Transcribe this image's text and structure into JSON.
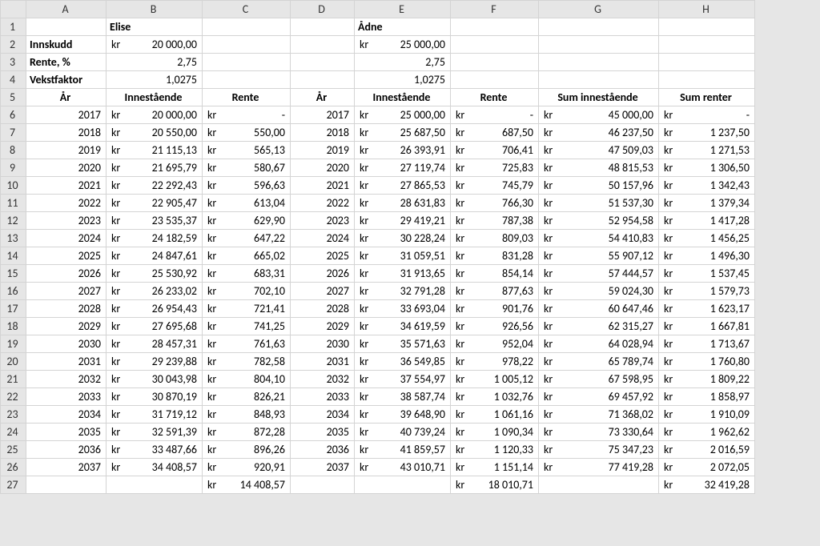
{
  "columns": [
    "A",
    "B",
    "C",
    "D",
    "E",
    "F",
    "G",
    "H"
  ],
  "row_count": 27,
  "labels": {
    "elise": "Elise",
    "adne": "Ådne",
    "innskudd": "Innskudd",
    "rente_pct": "Rente, %",
    "vekstfaktor": "Vekstfaktor",
    "ar": "År",
    "innestaende": "Innestående",
    "rente": "Rente",
    "sum_innestaende": "Sum innestående",
    "sum_renter": "Sum renter",
    "kr": "kr",
    "dash": "-"
  },
  "inputs": {
    "elise_innskudd": "20 000,00",
    "adne_innskudd": "25 000,00",
    "rente_pct": "2,75",
    "vekstfaktor": "1,0275"
  },
  "rows": [
    {
      "y": "2017",
      "eB": "20 000,00",
      "eR": "-",
      "aB": "25 000,00",
      "aR": "-",
      "sB": "45 000,00",
      "sR": "-"
    },
    {
      "y": "2018",
      "eB": "20 550,00",
      "eR": "550,00",
      "aB": "25 687,50",
      "aR": "687,50",
      "sB": "46 237,50",
      "sR": "1 237,50"
    },
    {
      "y": "2019",
      "eB": "21 115,13",
      "eR": "565,13",
      "aB": "26 393,91",
      "aR": "706,41",
      "sB": "47 509,03",
      "sR": "1 271,53"
    },
    {
      "y": "2020",
      "eB": "21 695,79",
      "eR": "580,67",
      "aB": "27 119,74",
      "aR": "725,83",
      "sB": "48 815,53",
      "sR": "1 306,50"
    },
    {
      "y": "2021",
      "eB": "22 292,43",
      "eR": "596,63",
      "aB": "27 865,53",
      "aR": "745,79",
      "sB": "50 157,96",
      "sR": "1 342,43"
    },
    {
      "y": "2022",
      "eB": "22 905,47",
      "eR": "613,04",
      "aB": "28 631,83",
      "aR": "766,30",
      "sB": "51 537,30",
      "sR": "1 379,34"
    },
    {
      "y": "2023",
      "eB": "23 535,37",
      "eR": "629,90",
      "aB": "29 419,21",
      "aR": "787,38",
      "sB": "52 954,58",
      "sR": "1 417,28"
    },
    {
      "y": "2024",
      "eB": "24 182,59",
      "eR": "647,22",
      "aB": "30 228,24",
      "aR": "809,03",
      "sB": "54 410,83",
      "sR": "1 456,25"
    },
    {
      "y": "2025",
      "eB": "24 847,61",
      "eR": "665,02",
      "aB": "31 059,51",
      "aR": "831,28",
      "sB": "55 907,12",
      "sR": "1 496,30"
    },
    {
      "y": "2026",
      "eB": "25 530,92",
      "eR": "683,31",
      "aB": "31 913,65",
      "aR": "854,14",
      "sB": "57 444,57",
      "sR": "1 537,45"
    },
    {
      "y": "2027",
      "eB": "26 233,02",
      "eR": "702,10",
      "aB": "32 791,28",
      "aR": "877,63",
      "sB": "59 024,30",
      "sR": "1 579,73"
    },
    {
      "y": "2028",
      "eB": "26 954,43",
      "eR": "721,41",
      "aB": "33 693,04",
      "aR": "901,76",
      "sB": "60 647,46",
      "sR": "1 623,17"
    },
    {
      "y": "2029",
      "eB": "27 695,68",
      "eR": "741,25",
      "aB": "34 619,59",
      "aR": "926,56",
      "sB": "62 315,27",
      "sR": "1 667,81"
    },
    {
      "y": "2030",
      "eB": "28 457,31",
      "eR": "761,63",
      "aB": "35 571,63",
      "aR": "952,04",
      "sB": "64 028,94",
      "sR": "1 713,67"
    },
    {
      "y": "2031",
      "eB": "29 239,88",
      "eR": "782,58",
      "aB": "36 549,85",
      "aR": "978,22",
      "sB": "65 789,74",
      "sR": "1 760,80"
    },
    {
      "y": "2032",
      "eB": "30 043,98",
      "eR": "804,10",
      "aB": "37 554,97",
      "aR": "1 005,12",
      "sB": "67 598,95",
      "sR": "1 809,22"
    },
    {
      "y": "2033",
      "eB": "30 870,19",
      "eR": "826,21",
      "aB": "38 587,74",
      "aR": "1 032,76",
      "sB": "69 457,92",
      "sR": "1 858,97"
    },
    {
      "y": "2034",
      "eB": "31 719,12",
      "eR": "848,93",
      "aB": "39 648,90",
      "aR": "1 061,16",
      "sB": "71 368,02",
      "sR": "1 910,09"
    },
    {
      "y": "2035",
      "eB": "32 591,39",
      "eR": "872,28",
      "aB": "40 739,24",
      "aR": "1 090,34",
      "sB": "73 330,64",
      "sR": "1 962,62"
    },
    {
      "y": "2036",
      "eB": "33 487,66",
      "eR": "896,26",
      "aB": "41 859,57",
      "aR": "1 120,33",
      "sB": "75 347,23",
      "sR": "2 016,59"
    },
    {
      "y": "2037",
      "eB": "34 408,57",
      "eR": "920,91",
      "aB": "43 010,71",
      "aR": "1 151,14",
      "sB": "77 419,28",
      "sR": "2 072,05"
    }
  ],
  "totals": {
    "elise_rente": "14 408,57",
    "adne_rente": "18 010,71",
    "sum_rente": "32 419,28"
  }
}
